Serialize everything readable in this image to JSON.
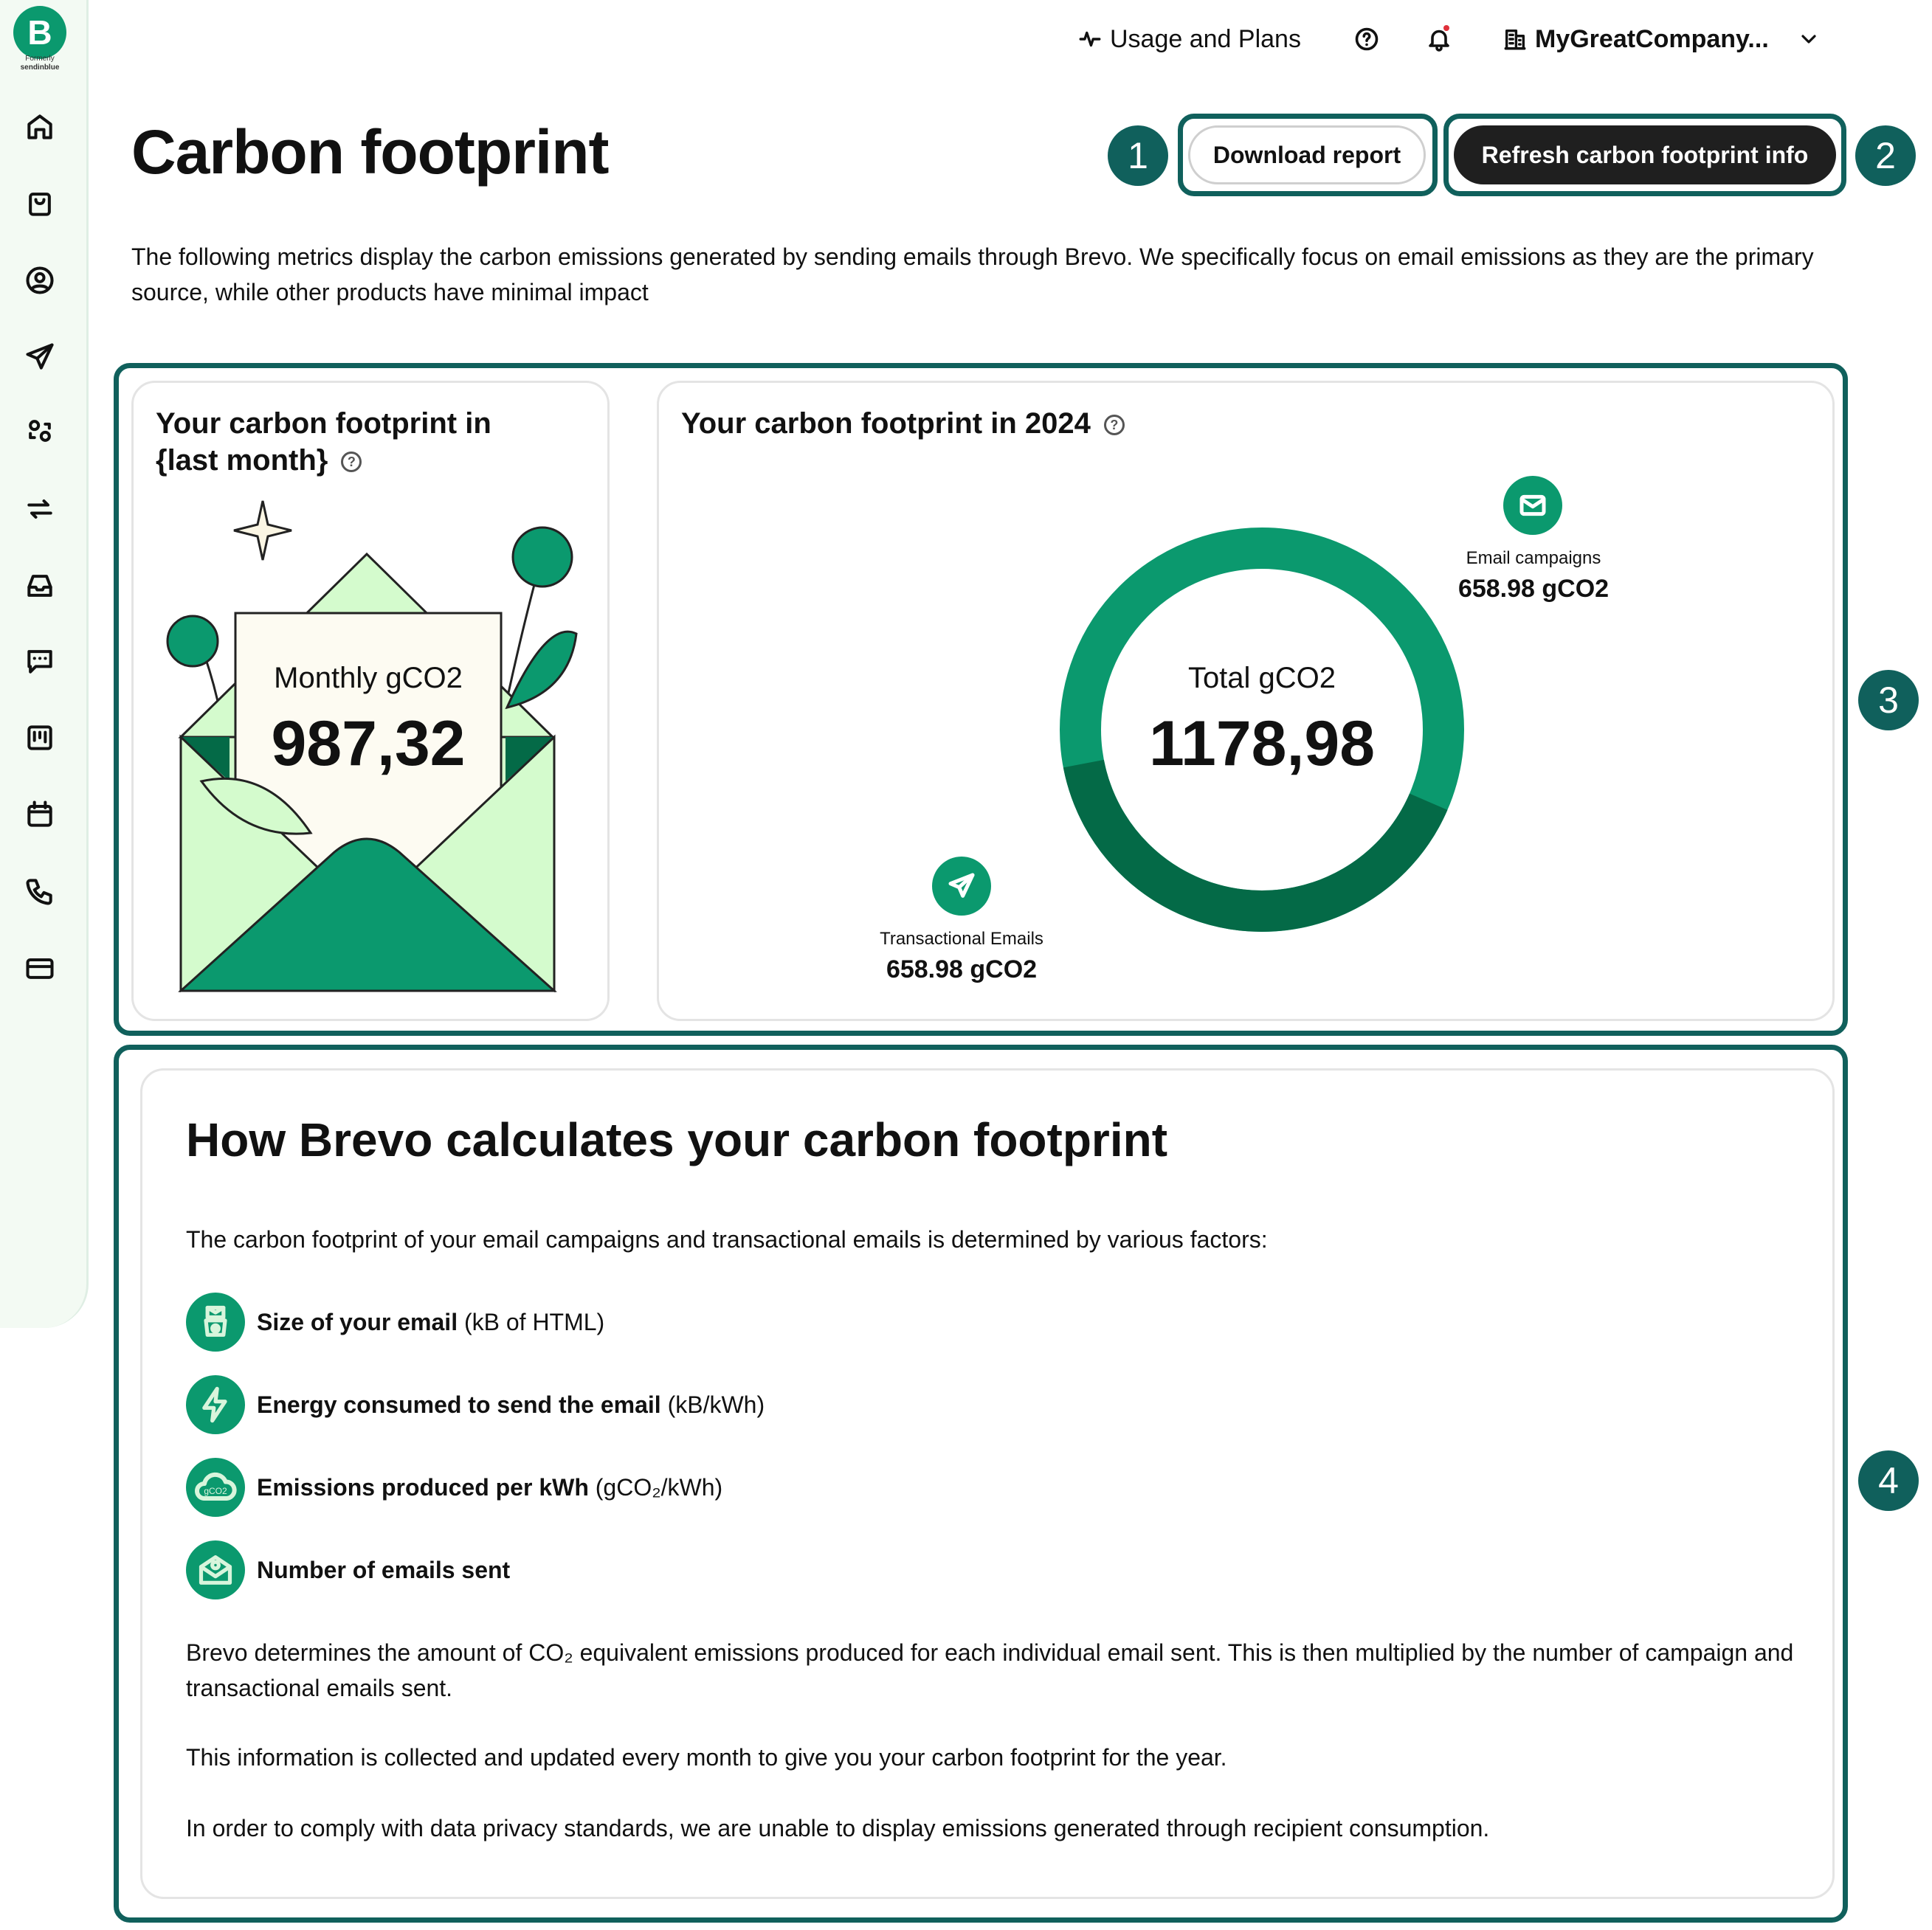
{
  "brand": {
    "letter": "B",
    "formerly": "Formerly",
    "old_name": "sendinblue"
  },
  "sidebar": {
    "icons": [
      "home-icon",
      "bag-icon",
      "contacts-icon",
      "send-icon",
      "automation-icon",
      "sync-icon",
      "inbox-icon",
      "chat-icon",
      "board-icon",
      "calendar-icon",
      "phone-icon",
      "card-icon"
    ]
  },
  "topbar": {
    "usage": "Usage and Plans",
    "company": "MyGreatCompany..."
  },
  "page": {
    "title": "Carbon footprint",
    "download_label": "Download report",
    "refresh_label": "Refresh carbon footprint info",
    "intro": "The following metrics display the carbon emissions generated by sending emails through Brevo. We specifically focus on email emissions as they are the primary source, while other products have minimal impact"
  },
  "annotations": [
    "1",
    "2",
    "3",
    "4"
  ],
  "monthly_card": {
    "title_line1": "Your carbon footprint in",
    "title_line2": "{last month}",
    "label": "Monthly gCO2",
    "value": "987,32"
  },
  "yearly_card": {
    "title": "Your carbon footprint in 2024",
    "center_label": "Total gCO2",
    "center_value": "1178,98",
    "email_label": "Email campaigns",
    "email_value": "658.98 gCO2",
    "trans_label": "Transactional Emails",
    "trans_value": "658.98 gCO2"
  },
  "chart_data": {
    "type": "pie",
    "categories": [
      "Email campaigns",
      "Transactional Emails"
    ],
    "values": [
      658.98,
      658.98
    ],
    "colors": [
      "#0b996e",
      "#046a47"
    ],
    "title": "Your carbon footprint in 2024"
  },
  "how": {
    "title": "How Brevo calculates your carbon footprint",
    "intro": "The carbon footprint of your email campaigns and transactional emails is determined by various factors:",
    "factors": [
      {
        "bold": "Size of your email",
        "unit": "(kB of HTML)"
      },
      {
        "bold": "Energy consumed to send the email",
        "unit": "(kB/kWh)"
      },
      {
        "bold": "Emissions produced per kWh",
        "unit": "(gCO₂/kWh)"
      },
      {
        "bold": "Number of emails sent",
        "unit": ""
      }
    ],
    "icon_badge": "gCO2",
    "p1": "Brevo determines the amount of CO₂ equivalent emissions produced for each individual email sent. This is then multiplied by the number of campaign and transactional emails sent.",
    "p2": "This information is collected and updated every month to give you your carbon footprint for the year.",
    "p3": "In order to comply with data privacy standards, we are unable to display emissions generated through recipient consumption."
  }
}
